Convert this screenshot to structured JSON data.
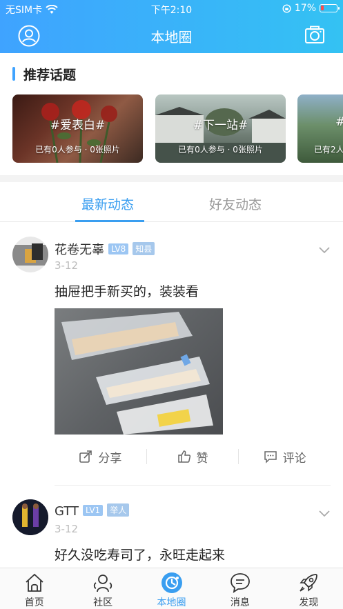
{
  "status": {
    "carrier": "无SIM卡",
    "time": "下午2:10",
    "battery": "17%"
  },
  "nav": {
    "title": "本地圈",
    "left_icon": "user-avatar-icon",
    "right_icon": "camera-icon"
  },
  "section": {
    "title": "推荐话题"
  },
  "topics": [
    {
      "title": "#爱表白#",
      "meta": "已有0人参与 · 0张照片"
    },
    {
      "title": "#下一站#",
      "meta": "已有0人参与 · 0张照片"
    },
    {
      "title": "#",
      "meta": "已有2人"
    }
  ],
  "tabs": {
    "latest": "最新动态",
    "friends": "好友动态"
  },
  "posts": [
    {
      "user": "花卷无辜",
      "level": "LV8",
      "rank": "知县",
      "date": "3-12",
      "content": "抽屉把手新买的，装装看"
    },
    {
      "user": "GTT",
      "level": "LV1",
      "rank": "举人",
      "date": "3-12",
      "content": "好久没吃寿司了，永旺走起来"
    }
  ],
  "actions": {
    "share": "分享",
    "like": "赞",
    "comment": "评论"
  },
  "tabbar": {
    "home": "首页",
    "community": "社区",
    "local": "本地圈",
    "messages": "消息",
    "discover": "发现"
  },
  "colors": {
    "accent": "#3a9ef0",
    "header_start": "#3fa3ff",
    "header_end": "#34c2f3"
  }
}
